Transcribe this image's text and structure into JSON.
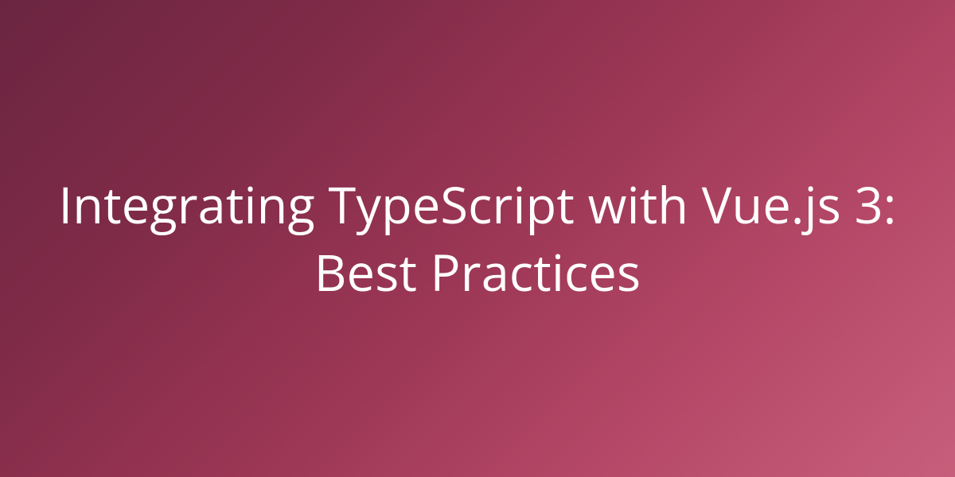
{
  "hero": {
    "title": "Integrating TypeScript with Vue.js 3: Best Practices"
  },
  "colors": {
    "gradient_start": "#6b2540",
    "gradient_end": "#c75f7b",
    "text": "#ffffff"
  }
}
